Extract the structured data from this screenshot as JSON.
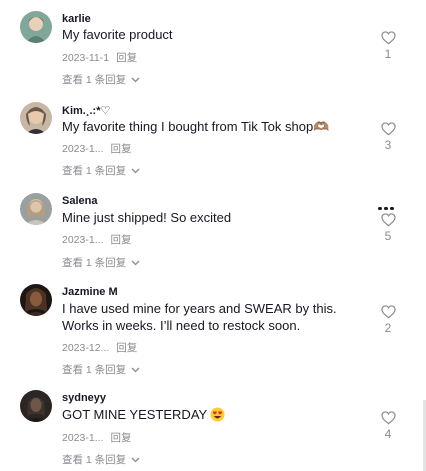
{
  "comments": [
    {
      "username": "karlie",
      "text": "My favorite product",
      "date": "2023-11-1",
      "reply_label": "回复",
      "view_replies": "查看 1 条回复",
      "likes": "1",
      "avatar_color": "#7fa89a"
    },
    {
      "username": "Kim.¸.:*♡",
      "text": "My favorite thing I bought from Tik Tok shop🫶🏽",
      "date": "2023-1...",
      "reply_label": "回复",
      "view_replies": "查看 1 条回复",
      "likes": "3",
      "avatar_color": "#c7b7a4"
    },
    {
      "username": "Salena",
      "text": "Mine just shipped! So excited",
      "date": "2023-1...",
      "reply_label": "回复",
      "view_replies": "查看 1 条回复",
      "likes": "5",
      "avatar_color": "#9aa0a0"
    },
    {
      "username": "Jazmine M",
      "text": "I have used mine for years and SWEAR by this. Works in weeks. I’ll need to restock soon.",
      "date": "2023-12...",
      "reply_label": "回复",
      "view_replies": "查看 1 条回复",
      "likes": "2",
      "avatar_color": "#3a2a1f"
    },
    {
      "username": "sydneyy",
      "text": "GOT MINE YESTERDAY",
      "emoji": "heart-eyes-emoji",
      "date": "2023-1...",
      "reply_label": "回复",
      "view_replies": "查看 1 条回复",
      "likes": "4",
      "avatar_color": "#2b2623"
    }
  ],
  "icons": {
    "like": "heart-outline-icon",
    "more": "more-horizontal-icon",
    "expand": "chevron-down-icon"
  },
  "colors": {
    "text_primary": "#161823",
    "text_secondary": "#8a8b91"
  }
}
